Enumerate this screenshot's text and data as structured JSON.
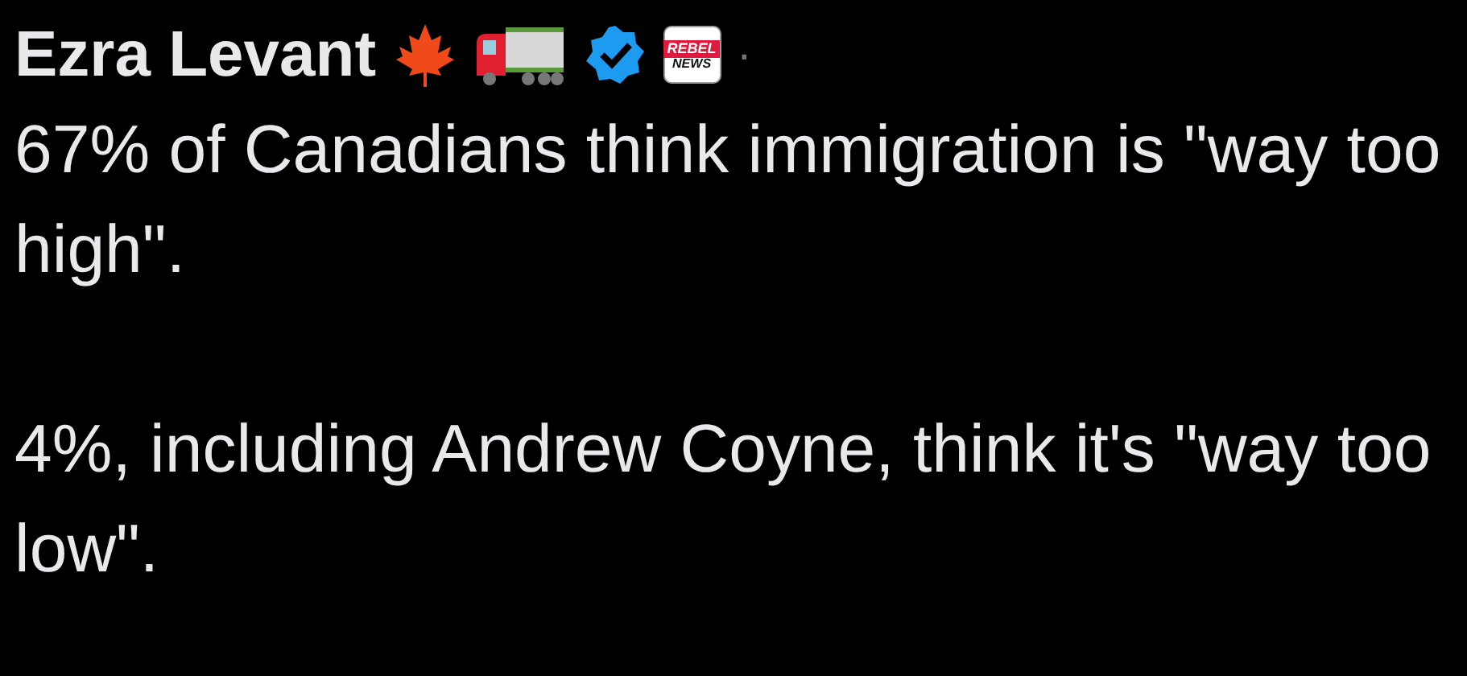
{
  "author": {
    "name": "Ezra Levant",
    "verified": true,
    "affiliate_badge": [
      "REBEL",
      "NEWS"
    ],
    "separator": "·"
  },
  "paragraphs": [
    "67% of Canadians think immigration is \"way too high\".",
    "4%, including Andrew Coyne, think it's \"way too low\"."
  ]
}
